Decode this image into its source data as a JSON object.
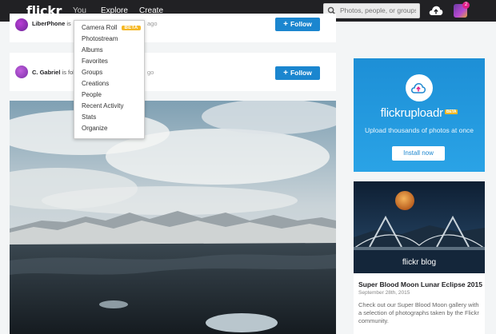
{
  "header": {
    "logo": "flickr",
    "nav": [
      "You",
      "Explore",
      "Create"
    ],
    "search_placeholder": "Photos, people, or groups",
    "notification_count": "2"
  },
  "you_menu": {
    "items": [
      "Camera Roll",
      "Photostream",
      "Albums",
      "Favorites",
      "Groups",
      "Creations",
      "People",
      "Recent Activity",
      "Stats",
      "Organize"
    ],
    "beta_label": "BETA"
  },
  "feed": [
    {
      "name": "LiberPhone",
      "partial_text": "is",
      "partial_time": "ago",
      "button": "Follow"
    },
    {
      "name": "C. Gabriel",
      "partial_text": "is fol",
      "partial_time": "go",
      "button": "Follow"
    }
  ],
  "promo": {
    "brand": "flickruploadr",
    "beta_label": "BETA",
    "subtitle": "Upload thousands of photos at once",
    "button": "Install now"
  },
  "blog": {
    "label": "flickr blog",
    "title": "Super Blood Moon Lunar Eclipse 2015",
    "date": "September 28th, 2015",
    "description": "Check out our Super Blood Moon gallery with a selection of photographs taken by the Flickr community."
  },
  "colors": {
    "topbar": "#212124",
    "accent_blue": "#1b86cf",
    "beta_yellow": "#f5b825",
    "page_bg": "#f3f5f6"
  }
}
